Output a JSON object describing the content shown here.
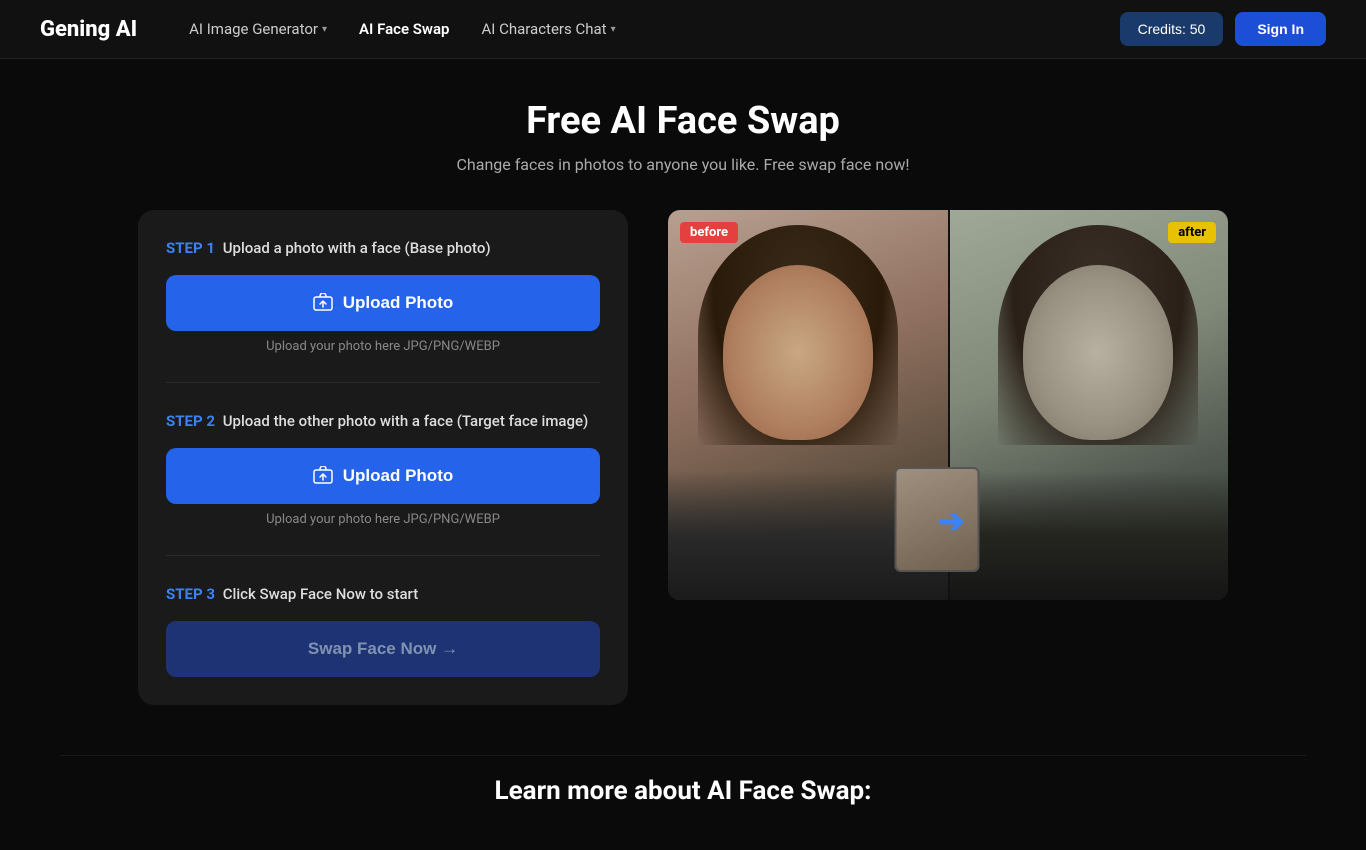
{
  "brand": {
    "logo": "Gening AI"
  },
  "navbar": {
    "links": [
      {
        "id": "ai-image-generator",
        "label": "AI Image Generator",
        "hasDropdown": true,
        "active": false
      },
      {
        "id": "ai-face-swap",
        "label": "AI Face Swap",
        "hasDropdown": false,
        "active": true
      },
      {
        "id": "ai-characters-chat",
        "label": "AI Characters Chat",
        "hasDropdown": true,
        "active": false
      }
    ],
    "credits_label": "Credits: 50",
    "signin_label": "Sign In"
  },
  "hero": {
    "title": "Free AI Face Swap",
    "subtitle": "Change faces in photos to anyone you like. Free swap face now!"
  },
  "steps": {
    "step1": {
      "number": "STEP 1",
      "description": "Upload a photo with a face (Base photo)",
      "button_label": "Upload Photo",
      "hint": "Upload your photo here JPG/PNG/WEBP"
    },
    "step2": {
      "number": "STEP 2",
      "description": "Upload the other photo with a face (Target face image)",
      "button_label": "Upload Photo",
      "hint": "Upload your photo here JPG/PNG/WEBP"
    },
    "step3": {
      "number": "STEP 3",
      "description": "Click Swap Face Now to start",
      "button_label": "Swap Face Now →"
    }
  },
  "preview": {
    "before_label": "before",
    "after_label": "after"
  },
  "bottom": {
    "title": "Learn more about AI Face Swap:"
  },
  "colors": {
    "accent_blue": "#2563eb",
    "step_blue": "#3b82f6",
    "before_red": "#e54040",
    "after_yellow": "#e8c200",
    "arrow_blue": "#3b82f6"
  }
}
